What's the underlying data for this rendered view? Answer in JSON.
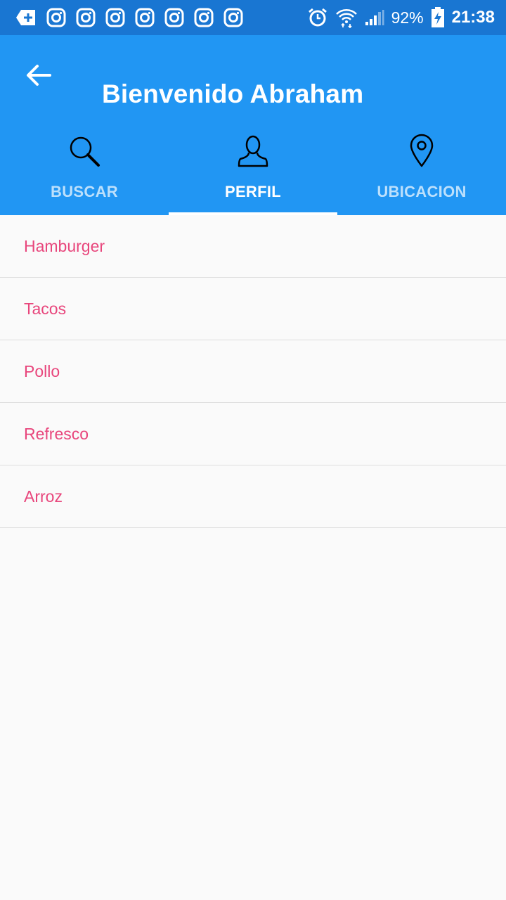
{
  "status_bar": {
    "battery": "92%",
    "time": "21:38",
    "notification_icons": [
      "add-notification-icon",
      "instagram-icon",
      "instagram-icon",
      "instagram-icon",
      "instagram-icon",
      "instagram-icon",
      "instagram-icon",
      "instagram-icon"
    ]
  },
  "header": {
    "title": "Bienvenido Abraham"
  },
  "tabs": [
    {
      "label": "BUSCAR",
      "icon": "search-icon",
      "active": false
    },
    {
      "label": "PERFIL",
      "icon": "person-icon",
      "active": true
    },
    {
      "label": "UBICACION",
      "icon": "location-pin-icon",
      "active": false
    }
  ],
  "list": {
    "items": [
      "Hamburger",
      "Tacos",
      "Pollo",
      "Refresco",
      "Arroz"
    ]
  },
  "colors": {
    "status_bar": "#1976d2",
    "app_bar": "#2196f3",
    "item_text": "#e8467c",
    "background": "#fafafa"
  }
}
